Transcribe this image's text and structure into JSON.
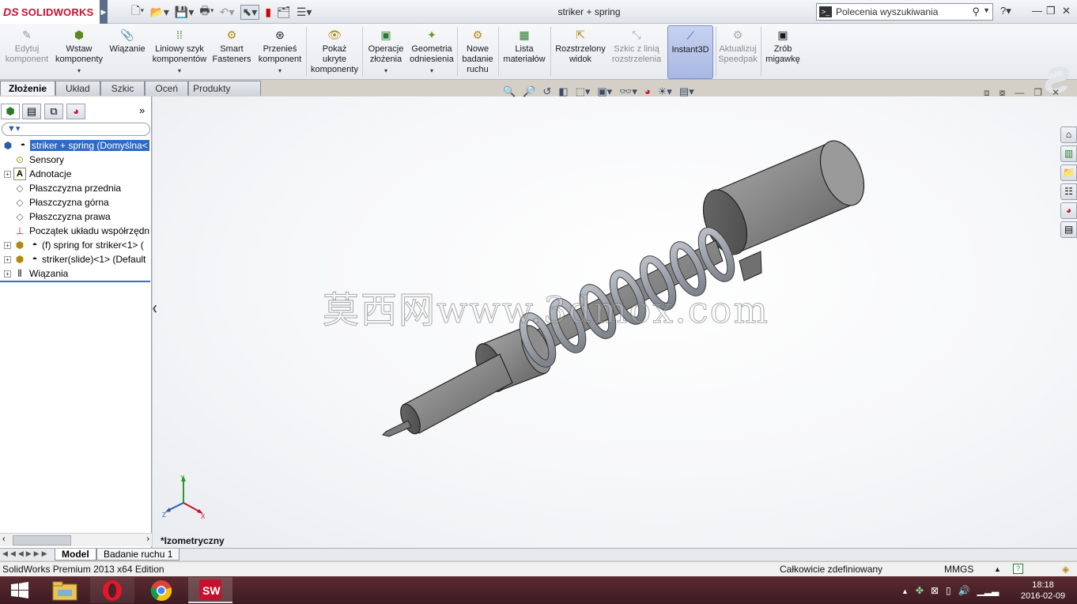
{
  "titlebar": {
    "brand": "SOLIDWORKS",
    "brand_prefix": "DS",
    "title": "striker + spring",
    "search_placeholder": "Polecenia wyszukiwania"
  },
  "ribbon": {
    "buttons": [
      {
        "label": "Edytuj komponent",
        "lines": [
          "Edytuj",
          "komponent"
        ],
        "disabled": true
      },
      {
        "label": "Wstaw komponenty",
        "lines": [
          "Wstaw",
          "komponenty"
        ]
      },
      {
        "label": "Wiązanie",
        "lines": [
          "Wiązanie"
        ]
      },
      {
        "label": "Liniowy szyk komponentów",
        "lines": [
          "Liniowy szyk",
          "komponentów"
        ]
      },
      {
        "label": "Smart Fasteners",
        "lines": [
          "Smart",
          "Fasteners"
        ]
      },
      {
        "label": "Przenieś komponent",
        "lines": [
          "Przenieś",
          "komponent"
        ]
      },
      {
        "label": "Pokaż ukryte komponenty",
        "lines": [
          "Pokaż",
          "ukryte",
          "komponenty"
        ]
      },
      {
        "label": "Operacje złożenia",
        "lines": [
          "Operacje",
          "złożenia"
        ]
      },
      {
        "label": "Geometria odniesienia",
        "lines": [
          "Geometria",
          "odniesienia"
        ]
      },
      {
        "label": "Nowe badanie ruchu",
        "lines": [
          "Nowe",
          "badanie",
          "ruchu"
        ]
      },
      {
        "label": "Lista materiałów",
        "lines": [
          "Lista",
          "materiałów"
        ]
      },
      {
        "label": "Rozstrzelony widok",
        "lines": [
          "Rozstrzelony",
          "widok"
        ]
      },
      {
        "label": "Szkic z linią rozstrzelenia",
        "lines": [
          "Szkic z linią",
          "rozstrzelenia"
        ],
        "disabled": true
      },
      {
        "label": "Instant3D",
        "lines": [
          "Instant3D"
        ],
        "active": true
      },
      {
        "label": "Aktualizuj Speedpak",
        "lines": [
          "Aktualizuj",
          "Speedpak"
        ],
        "disabled": true
      },
      {
        "label": "Zrób migawkę",
        "lines": [
          "Zrób",
          "migawkę"
        ]
      }
    ]
  },
  "tabs": [
    "Złożenie",
    "Układ",
    "Szkic",
    "Oceń",
    "Produkty Office"
  ],
  "tree": {
    "items": [
      {
        "label": "striker + spring  (Domyślna<",
        "selected": true
      },
      {
        "label": "Sensory"
      },
      {
        "label": "Adnotacje"
      },
      {
        "label": "Płaszczyzna przednia"
      },
      {
        "label": "Płaszczyzna górna"
      },
      {
        "label": "Płaszczyzna prawa"
      },
      {
        "label": "Początek układu współrzędn"
      },
      {
        "label": "(f) spring for striker<1> ("
      },
      {
        "label": "striker(slide)<1> (Default"
      },
      {
        "label": "Wiązania"
      }
    ]
  },
  "viewport": {
    "view_name": "*Izometryczny",
    "watermark": "莫西网www.3dmox.com",
    "triad": {
      "x": "X",
      "y": "Y",
      "z": "Z"
    }
  },
  "bottom_tabs": [
    "Model",
    "Badanie ruchu 1"
  ],
  "statusbar": {
    "edition": "SolidWorks Premium 2013 x64 Edition",
    "state": "Całkowicie zdefiniowany",
    "units": "MMGS"
  },
  "taskbar": {
    "time": "18:18",
    "date": "2016-02-09"
  },
  "colors": {
    "accent": "#316ac5",
    "brand": "#c8102e",
    "taskbar": "#4a2228"
  }
}
